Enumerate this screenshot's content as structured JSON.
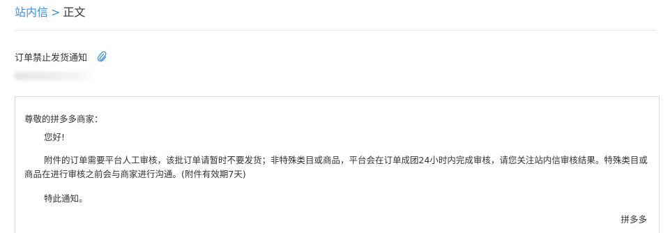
{
  "breadcrumb": {
    "parent": "站内信",
    "separator": ">",
    "current": "正文"
  },
  "message": {
    "subject": "订单禁止发货通知",
    "attachment_icon": "paperclip-icon",
    "greeting": "尊敬的拼多多商家：",
    "hello": "您好!",
    "body": "附件的订单需要平台人工审核，该批订单请暂时不要发货；非特殊类目或商品，平台会在订单成团24小时内完成审核，请您关注站内信审核结果。特殊类目或商品在进行审核之前会与商家进行沟通。(附件有效期7天)",
    "closing": "特此通知。",
    "signature": "拼多多"
  },
  "colors": {
    "link": "#3a8ee6",
    "text": "#333333",
    "border": "#d9d9d9"
  }
}
